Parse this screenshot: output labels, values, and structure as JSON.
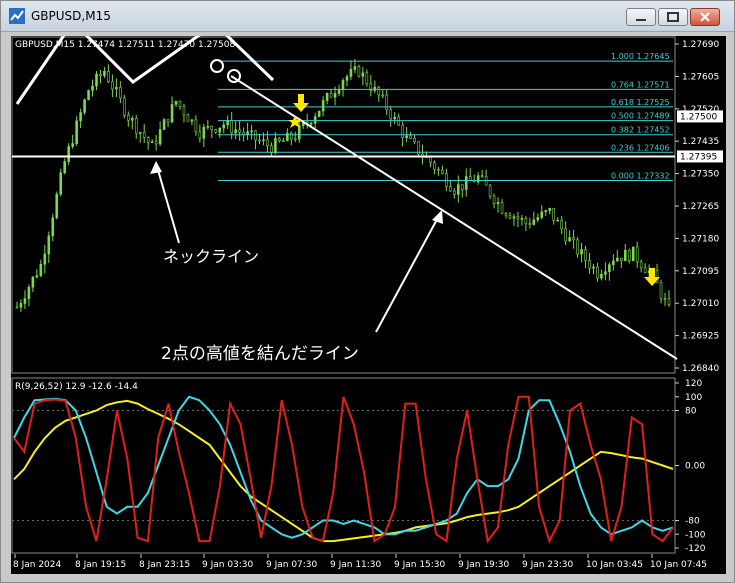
{
  "window": {
    "title": "GBPUSD,M15"
  },
  "price_panel": {
    "header": "GBPUSD,M15  1.27474 1.27511 1.27470 1.27508",
    "price_labels": [
      "1.27690",
      "1.27605",
      "1.27520",
      "1.27435",
      "1.27350",
      "1.27265",
      "1.27180",
      "1.27095",
      "1.27010",
      "1.26925",
      "1.26840"
    ],
    "fib_levels": [
      {
        "label": "1.000",
        "value": "1.27645"
      },
      {
        "label": "0.764",
        "value": "1.27571"
      },
      {
        "label": "0.618",
        "value": "1.27525"
      },
      {
        "label": "0.500",
        "value": "1.27489"
      },
      {
        "label": "0.382",
        "value": "1.27452"
      },
      {
        "label": "0.236",
        "value": "1.27406"
      },
      {
        "label": "0.000",
        "value": "1.27332"
      }
    ],
    "highlight_labels": {
      "current_price": "1.27500",
      "neckline_price": "1.27395"
    },
    "annotations": {
      "neckline": "ネックライン",
      "trendline": "2点の高値を結んだライン"
    }
  },
  "indicator_panel": {
    "header": "R(9,26,52) 12.9 -12.6 -14.4",
    "scale_labels": [
      "120",
      "100",
      "80",
      "0.00",
      "-80",
      "-100",
      "-120"
    ]
  },
  "time_axis": [
    "8 Jan 2024",
    "8 Jan 19:15",
    "8 Jan 23:15",
    "9 Jan 03:30",
    "9 Jan 07:30",
    "9 Jan 11:30",
    "9 Jan 15:30",
    "9 Jan 19:30",
    "9 Jan 23:30",
    "10 Jan 03:45",
    "10 Jan 07:45"
  ],
  "colors": {
    "background": "#000000",
    "candles": "#7fd650",
    "fib": "#3fd0d0",
    "oscillator_red": "#e0201a",
    "oscillator_cyan": "#3fd8e6",
    "oscillator_yellow": "#f5ee25",
    "markers": "#ffe800"
  },
  "chart_data": {
    "type": "line",
    "title": "GBPUSD,M15",
    "ylim": [
      1.2684,
      1.2769
    ],
    "x": [
      "8 Jan 2024",
      "8 Jan 19:15",
      "8 Jan 23:15",
      "9 Jan 03:30",
      "9 Jan 07:30",
      "9 Jan 11:30",
      "9 Jan 15:30",
      "9 Jan 19:30",
      "9 Jan 23:30",
      "10 Jan 03:45",
      "10 Jan 07:45"
    ],
    "series": [
      {
        "values": [
          1.27,
          1.2752,
          1.2746,
          1.276,
          1.2739,
          1.2726,
          1.2712,
          1.2702,
          1.2712,
          1.2701,
          1.2693
        ]
      }
    ],
    "grid": false
  }
}
